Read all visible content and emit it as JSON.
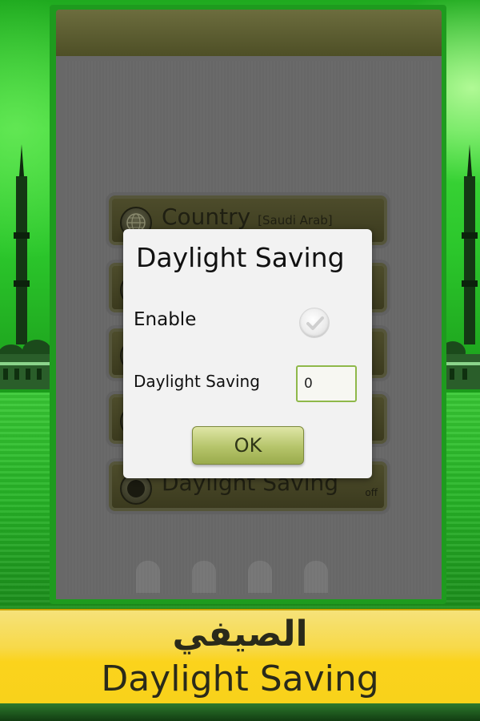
{
  "app": {
    "menu": [
      {
        "label": "Country",
        "sub": "[Saudi Arab]",
        "value": ""
      },
      {
        "label": "",
        "sub": "",
        "value": ""
      },
      {
        "label": "",
        "sub": "",
        "value": ""
      },
      {
        "label": "",
        "sub": "",
        "value": ""
      },
      {
        "label": "Daylight Saving",
        "sub": "",
        "value": "off"
      }
    ]
  },
  "dialog": {
    "title": "Daylight Saving",
    "enable_label": "Enable",
    "enable_checked": false,
    "daylight_label": "Daylight Saving",
    "daylight_value": "0",
    "ok_label": "OK"
  },
  "banner": {
    "arabic": "الصيفي",
    "english": "Daylight Saving"
  },
  "colors": {
    "accent_green": "#1e9b1e",
    "banner_yellow": "#f7d949",
    "ok_button": "#b5c46a"
  },
  "icons": {
    "country": "globe-icon",
    "daylight": "moon-icon",
    "check": "check-icon"
  }
}
